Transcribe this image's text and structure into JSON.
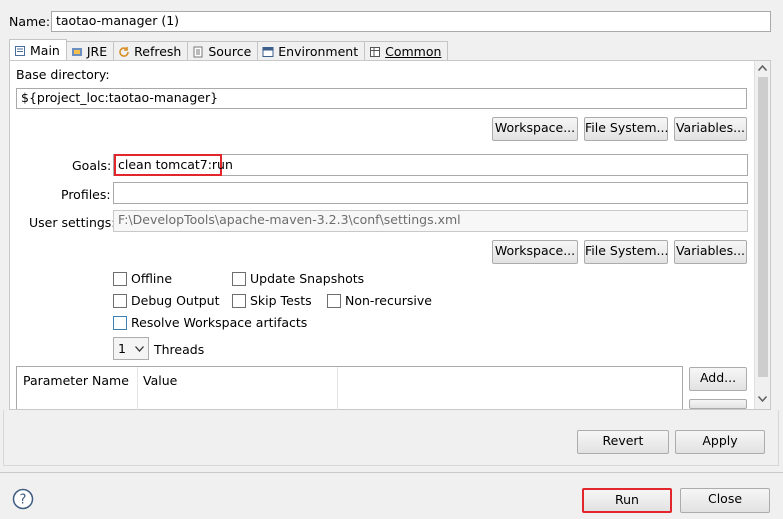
{
  "name_label": "Name:",
  "name_value": "taotao-manager (1)",
  "tabs": [
    {
      "label": "Main",
      "icon": "main-tab-icon"
    },
    {
      "label": "JRE",
      "icon": "jre-icon"
    },
    {
      "label": "Refresh",
      "icon": "refresh-icon"
    },
    {
      "label": "Source",
      "icon": "source-icon"
    },
    {
      "label": "Environment",
      "icon": "environment-icon"
    },
    {
      "label": "Common",
      "icon": "common-icon"
    }
  ],
  "base_dir": {
    "label": "Base directory:",
    "value": "${project_loc:taotao-manager}"
  },
  "buttons": {
    "workspace": "Workspace...",
    "filesystem": "File System...",
    "variables": "Variables..."
  },
  "goals": {
    "label": "Goals:",
    "value": "clean tomcat7:run"
  },
  "profiles": {
    "label": "Profiles:",
    "value": ""
  },
  "user_settings": {
    "label": "User settings:",
    "value": "F:\\DevelopTools\\apache-maven-3.2.3\\conf\\settings.xml"
  },
  "options": {
    "offline": "Offline",
    "update_snapshots": "Update Snapshots",
    "debug_output": "Debug Output",
    "skip_tests": "Skip Tests",
    "non_recursive": "Non-recursive",
    "resolve_workspace": "Resolve Workspace artifacts"
  },
  "threads": {
    "value": "1",
    "label": "Threads"
  },
  "param_table": {
    "headers": [
      "Parameter Name",
      "Value"
    ]
  },
  "add_button": "Add...",
  "revert_button": "Revert",
  "apply_button": "Apply",
  "run_button": "Run",
  "close_button": "Close",
  "highlight_color": "#e3262b"
}
